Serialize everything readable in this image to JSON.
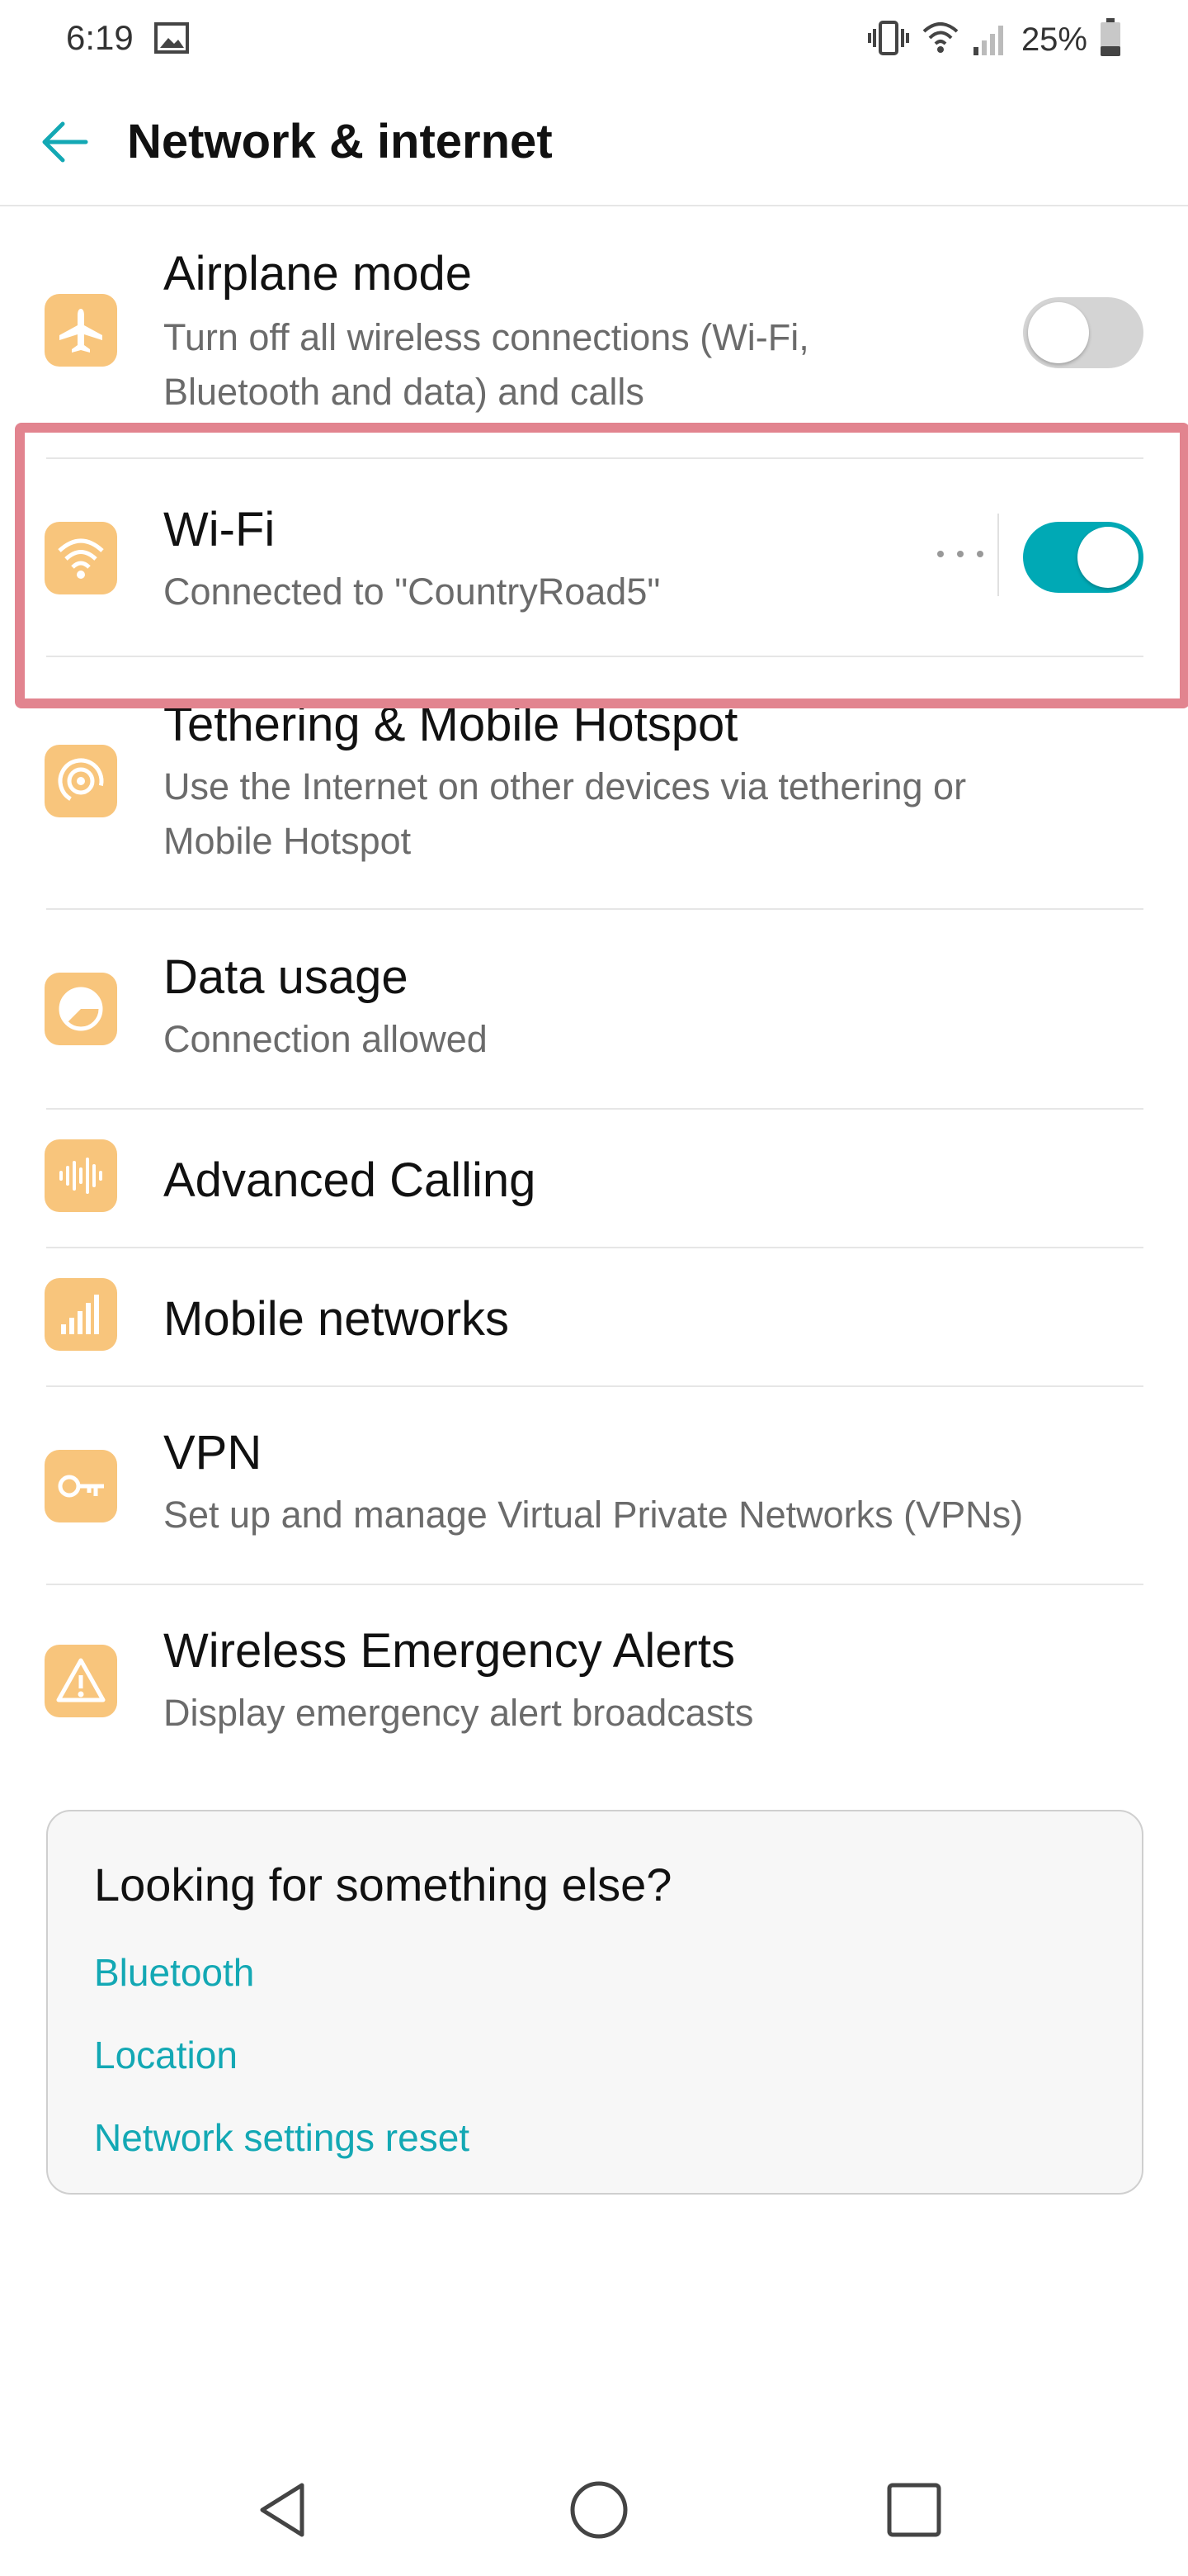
{
  "status_bar": {
    "time": "6:19",
    "battery_text": "25%"
  },
  "app_bar": {
    "title": "Network & internet"
  },
  "items": [
    {
      "title": "Airplane mode",
      "subtitle_line1": "Turn off all wireless connections (Wi-Fi,",
      "subtitle_line2": "Bluetooth and data) and calls",
      "icon": "airplane-icon",
      "toggle": false
    },
    {
      "title": "Wi-Fi",
      "subtitle": "Connected to \"CountryRoad5\"",
      "icon": "wifi-icon",
      "toggle": true
    },
    {
      "title": "Tethering & Mobile Hotspot",
      "subtitle_line1": "Use the Internet on other devices via tethering or",
      "subtitle_line2": "Mobile Hotspot",
      "icon": "hotspot-icon"
    },
    {
      "title": "Data usage",
      "subtitle": "Connection allowed",
      "icon": "data-usage-icon"
    },
    {
      "title": "Advanced Calling",
      "icon": "sound-wave-icon"
    },
    {
      "title": "Mobile networks",
      "icon": "signal-bars-icon"
    },
    {
      "title": "VPN",
      "subtitle": "Set up and manage Virtual Private Networks (VPNs)",
      "icon": "key-icon"
    },
    {
      "title": "Wireless Emergency Alerts",
      "subtitle": "Display emergency alert broadcasts",
      "icon": "warning-icon"
    }
  ],
  "suggestions": {
    "title": "Looking for something else?",
    "links": [
      "Bluetooth",
      "Location",
      "Network settings reset"
    ]
  },
  "colors": {
    "accent": "#00a9b5",
    "icon_bg": "#f8c57c",
    "highlight": "#e2848f"
  }
}
